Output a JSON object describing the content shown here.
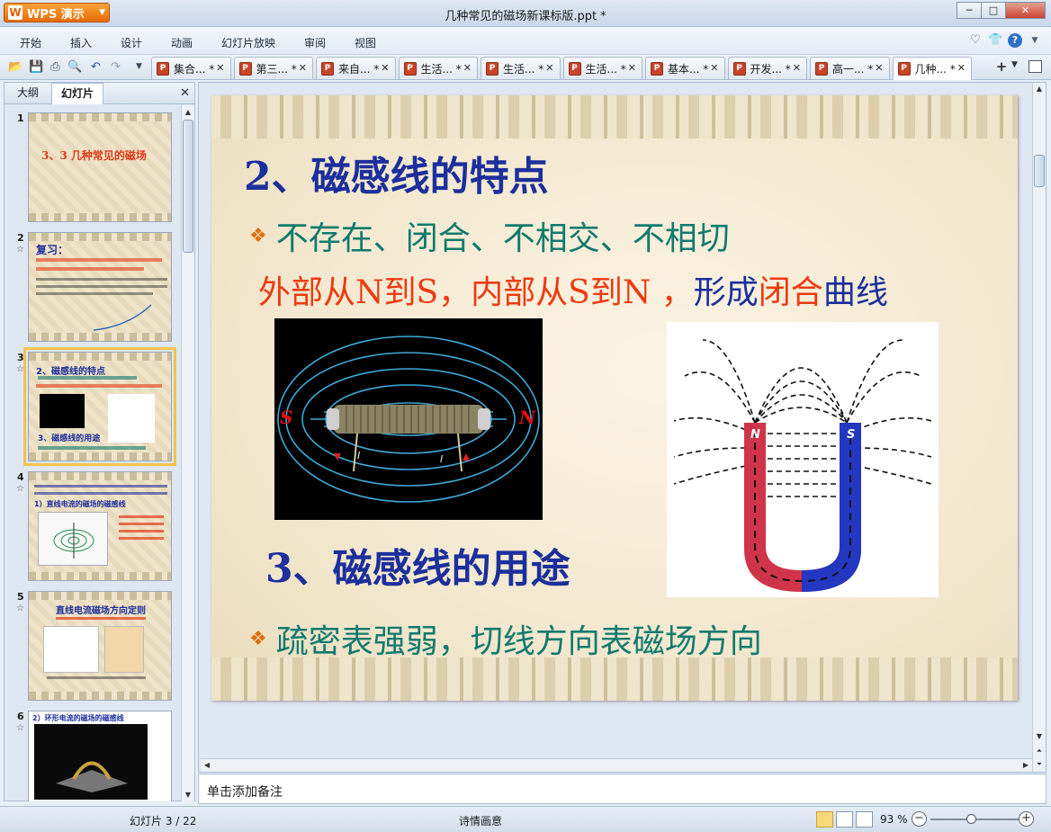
{
  "window": {
    "app_name": "WPS 演示",
    "title": "几种常见的磁场新课标版.ppt *",
    "controls": {
      "minimize": "─",
      "maximize": "□",
      "close": "✕"
    }
  },
  "menu": {
    "items": [
      "开始",
      "插入",
      "设计",
      "动画",
      "幻灯片放映",
      "审阅",
      "视图"
    ]
  },
  "doc_tabs": [
    {
      "label": "集合... *"
    },
    {
      "label": "第三... *"
    },
    {
      "label": "来自... *"
    },
    {
      "label": "生活... *"
    },
    {
      "label": "生活... *"
    },
    {
      "label": "生活... *"
    },
    {
      "label": "基本... *"
    },
    {
      "label": "开发... *"
    },
    {
      "label": "高一... *"
    },
    {
      "label": "几种... *",
      "active": true
    }
  ],
  "doc_icon_glyph": "P",
  "left_panel": {
    "tabs": [
      "大纲",
      "幻灯片"
    ],
    "active_tab": "幻灯片",
    "star": "☆",
    "thumbnails": [
      {
        "num": "1",
        "title": "3、3 几种常见的磁场",
        "has_star": false
      },
      {
        "num": "2",
        "title": "复习：",
        "has_star": true
      },
      {
        "num": "3",
        "title": "2、磁感线的特点",
        "subtitle": "3、磁感线的用途",
        "has_star": true,
        "selected": true
      },
      {
        "num": "4",
        "title": "1）直线电流的磁场的磁感线",
        "has_star": true
      },
      {
        "num": "5",
        "title": "直线电流磁场方向定则",
        "has_star": true
      },
      {
        "num": "6",
        "title": "2）环形电流的磁场的磁感线",
        "has_star": true
      }
    ]
  },
  "slide": {
    "heading1": "2、磁感线的特点",
    "bullet1": "不存在、闭合、不相交、不相切",
    "line_segments": [
      {
        "text": "外部从N到S，内部从S到N ，",
        "color": "red"
      },
      {
        "text": "形成",
        "color": "blue"
      },
      {
        "text": "闭合",
        "color": "red"
      },
      {
        "text": "曲线",
        "color": "blue"
      }
    ],
    "heading2": "3、磁感线的用途",
    "bullet2": "疏密表强弱，切线方向表磁场方向",
    "bullet_glyph": "❖",
    "coil_labels": {
      "left": "S",
      "right": "N",
      "current": "I"
    },
    "magnet_labels": {
      "left": "N",
      "right": "S"
    }
  },
  "notes": {
    "placeholder": "单击添加备注"
  },
  "status": {
    "slide_info": "幻灯片 3 / 22",
    "theme": "诗情画意",
    "zoom": "93 %",
    "zoom_level": 0.46
  },
  "colors": {
    "heading": "#1c2f9c",
    "bullet": "#0f7a6e",
    "red_text": "#ec3a10",
    "diamond": "#e07010"
  }
}
